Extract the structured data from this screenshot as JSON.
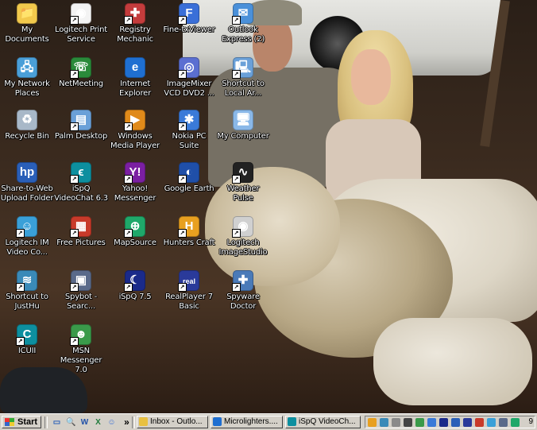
{
  "desktop": {
    "icons": [
      {
        "label": "My Documents",
        "icon": "folder-documents-icon",
        "color": "#f2c94c",
        "glyph": "📁",
        "shortcut": false
      },
      {
        "label": "Logitech Print\nService",
        "icon": "camera-print-icon",
        "color": "#f3f3f3",
        "glyph": "◉",
        "shortcut": true
      },
      {
        "label": "Registry\nMechanic",
        "icon": "registry-mechanic-icon",
        "color": "#c43c3c",
        "glyph": "✚",
        "shortcut": true
      },
      {
        "label": "Fine-txViewer",
        "icon": "fine-viewer-icon",
        "color": "#3a6fd8",
        "glyph": "F",
        "shortcut": true
      },
      {
        "label": "Outlook\nExpress (2)",
        "icon": "outlook-express-icon",
        "color": "#4a90d9",
        "glyph": "✉",
        "shortcut": true
      },
      {
        "label": "My Network\nPlaces",
        "icon": "network-places-icon",
        "color": "#4a9fd8",
        "glyph": "🖧",
        "shortcut": false
      },
      {
        "label": "NetMeeting",
        "icon": "netmeeting-icon",
        "color": "#2a8a3a",
        "glyph": "☏",
        "shortcut": true
      },
      {
        "label": "Internet\nExplorer",
        "icon": "internet-explorer-icon",
        "color": "#1f6fd1",
        "glyph": "e",
        "shortcut": false
      },
      {
        "label": "ImageMixer\nVCD DVD2 ...",
        "icon": "imagemixer-icon",
        "color": "#5b6fd1",
        "glyph": "◎",
        "shortcut": true
      },
      {
        "label": "Shortcut to\nLocal Ar...",
        "icon": "local-area-network-icon",
        "color": "#6aa0d8",
        "glyph": "🖳",
        "shortcut": true
      },
      {
        "label": "Recycle Bin",
        "icon": "recycle-bin-icon",
        "color": "#a8b8c8",
        "glyph": "♻",
        "shortcut": false
      },
      {
        "label": "Palm Desktop",
        "icon": "palm-desktop-icon",
        "color": "#6aa0d8",
        "glyph": "▤",
        "shortcut": true
      },
      {
        "label": "Windows\nMedia Player",
        "icon": "media-player-icon",
        "color": "#e08a1a",
        "glyph": "▶",
        "shortcut": true
      },
      {
        "label": "Nokia PC Suite",
        "icon": "nokia-pc-suite-icon",
        "color": "#3a7ad8",
        "glyph": "✱",
        "shortcut": true
      },
      {
        "label": "My Computer",
        "icon": "my-computer-icon",
        "color": "#8ab8e8",
        "glyph": "🖥",
        "shortcut": false
      },
      {
        "label": "Share-to-Web\nUpload Folder",
        "icon": "share-to-web-icon",
        "color": "#2a5fb8",
        "glyph": "hp",
        "shortcut": false
      },
      {
        "label": "iSpQ\nVideoChat 6.3",
        "icon": "ispq-videochat-icon",
        "color": "#0d8f9f",
        "glyph": "ϵ",
        "shortcut": true
      },
      {
        "label": "Yahoo!\nMessenger",
        "icon": "yahoo-messenger-icon",
        "color": "#7b1fa2",
        "glyph": "Y!",
        "shortcut": true
      },
      {
        "label": "Google Earth",
        "icon": "google-earth-icon",
        "color": "#1f4fa8",
        "glyph": "◐",
        "shortcut": true
      },
      {
        "label": "Weather Pulse",
        "icon": "weather-pulse-icon",
        "color": "#222222",
        "glyph": "∿",
        "shortcut": true
      },
      {
        "label": "Logitech IM\nVideo Co...",
        "icon": "logitech-im-icon",
        "color": "#3aa0d8",
        "glyph": "☺",
        "shortcut": true
      },
      {
        "label": "Free Pictures",
        "icon": "free-pictures-icon",
        "color": "#c83a2a",
        "glyph": "▦",
        "shortcut": true
      },
      {
        "label": "MapSource",
        "icon": "mapsource-icon",
        "color": "#1fa86a",
        "glyph": "⊕",
        "shortcut": true
      },
      {
        "label": "Hunters Craft",
        "icon": "hunters-craft-icon",
        "color": "#e8a020",
        "glyph": "H",
        "shortcut": true
      },
      {
        "label": "Logitech\nImageStudio",
        "icon": "logitech-imagestudio-icon",
        "color": "#d0d0d0",
        "glyph": "◉",
        "shortcut": true
      },
      {
        "label": "Shortcut to\nJustHu",
        "icon": "justhu-shortcut-icon",
        "color": "#3a8ab8",
        "glyph": "≋",
        "shortcut": true
      },
      {
        "label": "Spybot -\nSearc...",
        "icon": "spybot-icon",
        "color": "#5a6a8a",
        "glyph": "▣",
        "shortcut": true
      },
      {
        "label": "iSpQ 7.5",
        "icon": "ispq-icon",
        "color": "#1a2a8a",
        "glyph": "☾",
        "shortcut": true
      },
      {
        "label": "RealPlayer 7\nBasic",
        "icon": "realplayer-icon",
        "color": "#2a3a9a",
        "glyph": "real",
        "shortcut": true
      },
      {
        "label": "Spyware\nDoctor",
        "icon": "spyware-doctor-icon",
        "color": "#4a7ab8",
        "glyph": "✚",
        "shortcut": true
      },
      {
        "label": "ICUII",
        "icon": "icuii-icon",
        "color": "#0d8f9f",
        "glyph": "C",
        "shortcut": true
      },
      {
        "label": "MSN\nMessenger 7.0",
        "icon": "msn-messenger-icon",
        "color": "#3a9a4a",
        "glyph": "☻",
        "shortcut": true
      }
    ]
  },
  "taskbar": {
    "start_label": "Start",
    "quick_launch": [
      {
        "icon": "show-desktop-icon",
        "glyph": "▭",
        "color": "#2a5fb8"
      },
      {
        "icon": "search-icon",
        "glyph": "🔍",
        "color": "#444444"
      },
      {
        "icon": "word-icon",
        "glyph": "W",
        "color": "#1f4fa8"
      },
      {
        "icon": "excel-icon",
        "glyph": "X",
        "color": "#1f7a3a"
      },
      {
        "icon": "messenger-icon",
        "glyph": "☺",
        "color": "#3a6fd8"
      }
    ],
    "chevron": "»",
    "tasks": [
      {
        "label": "Inbox - Outlo...",
        "icon": "outlook-inbox-icon",
        "color": "#e8c040"
      },
      {
        "label": "Microlighters....",
        "icon": "ie-window-icon",
        "color": "#1f6fd1"
      },
      {
        "label": "iSpQ VideoCh...",
        "icon": "ispq-window-icon",
        "color": "#0d8f9f"
      }
    ],
    "tray_icons": [
      {
        "icon": "tray-antivirus-icon",
        "color": "#e8a020"
      },
      {
        "icon": "tray-network-icon",
        "color": "#3a8ab8"
      },
      {
        "icon": "tray-spyware-icon",
        "color": "#8a8a8a"
      },
      {
        "icon": "tray-volume-icon",
        "color": "#444444"
      },
      {
        "icon": "tray-messenger-icon",
        "color": "#3a9a4a"
      },
      {
        "icon": "tray-nokia-icon",
        "color": "#3a7ad8"
      },
      {
        "icon": "tray-ispq-icon",
        "color": "#1a2a8a"
      },
      {
        "icon": "tray-help-icon",
        "color": "#2a5fb8"
      },
      {
        "icon": "tray-realplayer-icon",
        "color": "#2a3a9a"
      },
      {
        "icon": "tray-update-icon",
        "color": "#c83a2a"
      },
      {
        "icon": "tray-shield-icon",
        "color": "#3aa0d8"
      },
      {
        "icon": "tray-display-icon",
        "color": "#5a6a8a"
      },
      {
        "icon": "tray-connection-icon",
        "color": "#1fa86a"
      }
    ],
    "clock": "9"
  }
}
